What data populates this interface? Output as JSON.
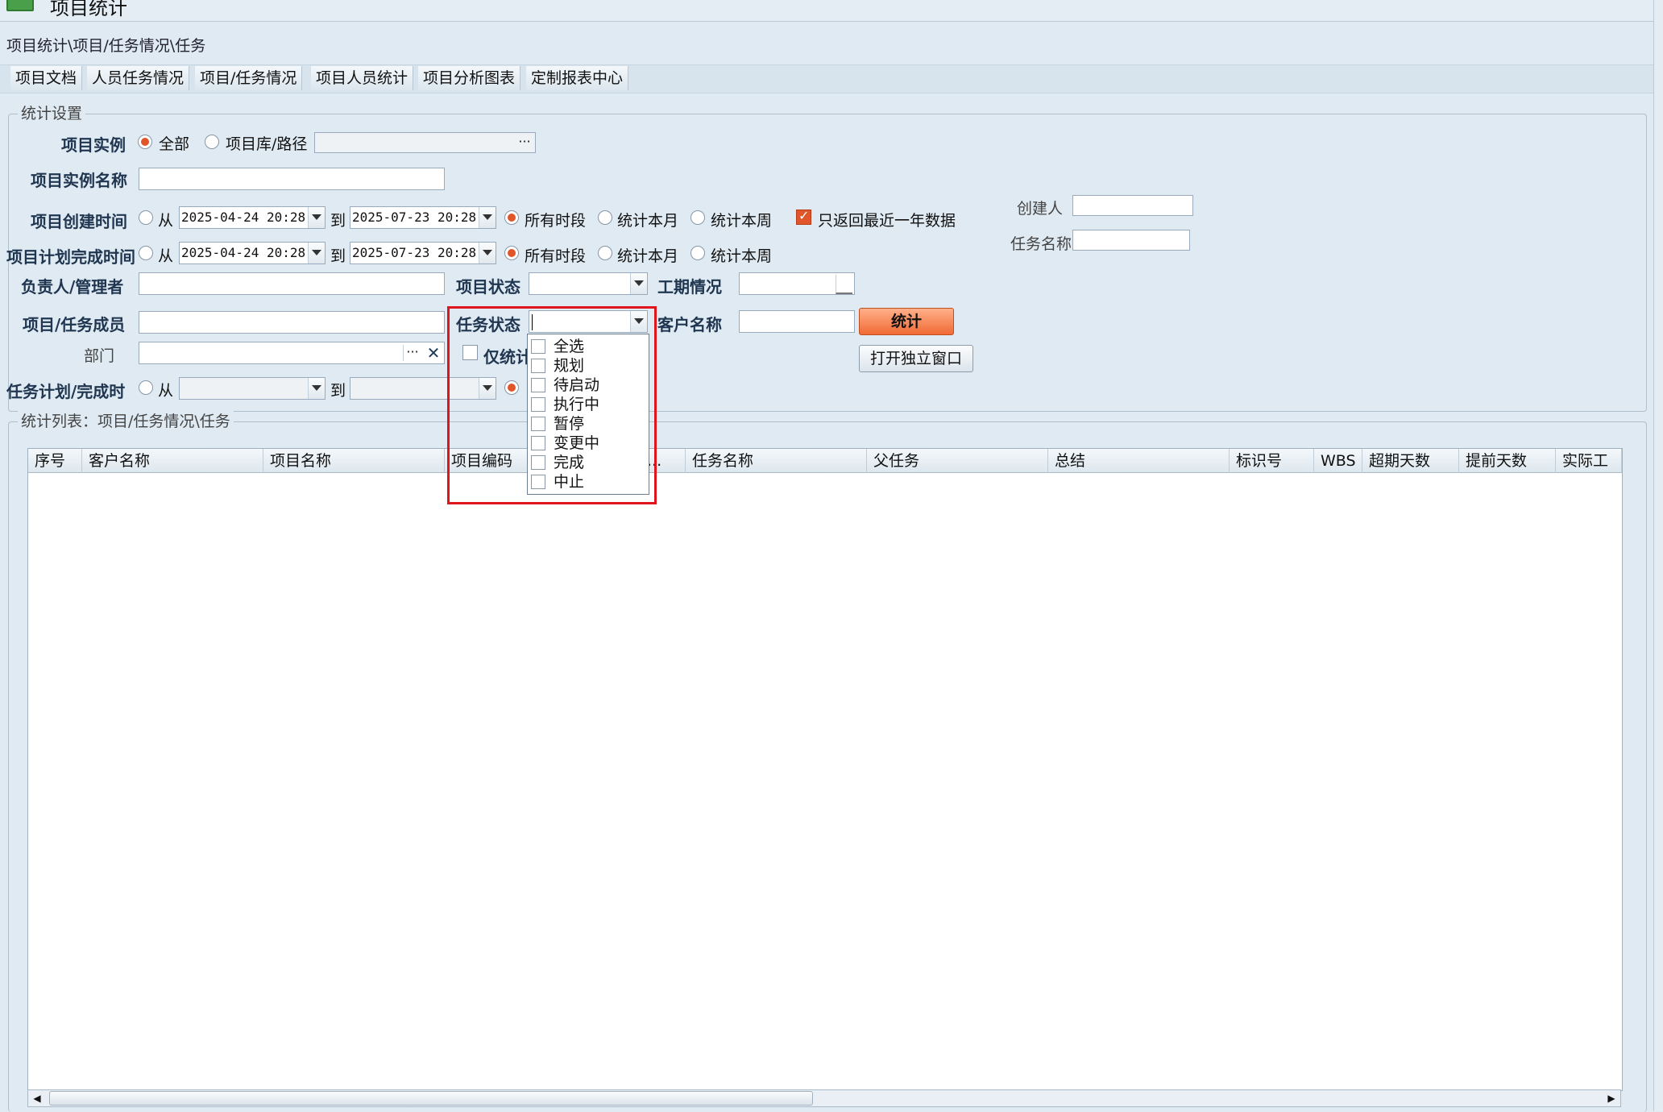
{
  "window": {
    "title": "项目统计"
  },
  "breadcrumb": "项目统计\\项目/任务情况\\任务",
  "tabs": [
    "项目文档",
    "人员任务情况",
    "项目/任务情况",
    "项目人员统计",
    "项目分析图表",
    "定制报表中心"
  ],
  "settings": {
    "legend": "统计设置",
    "instance": {
      "label": "项目实例",
      "opt_all": "全部",
      "opt_path": "项目库/路径"
    },
    "instance_name_label": "项目实例名称",
    "create_time": {
      "label": "项目创建时间",
      "from": "从",
      "from_value": "2025-04-24 20:28:",
      "to": "到",
      "to_value": "2025-07-23 20:28:",
      "opt_all": "所有时段",
      "opt_month": "统计本月",
      "opt_week": "统计本周",
      "last_year": "只返回最近一年数据"
    },
    "plan_time": {
      "label": "项目计划完成时间",
      "from": "从",
      "from_value": "2025-04-24 20:28:",
      "to": "到",
      "to_value": "2025-07-23 20:28:",
      "opt_all": "所有时段",
      "opt_month": "统计本月",
      "opt_week": "统计本周"
    },
    "creator_label": "创建人",
    "task_name_label": "任务名称",
    "manager_label": "负责人/管理者",
    "project_status_label": "项目状态",
    "duration_label": "工期情况",
    "member_label": "项目/任务成员",
    "task_status_label": "任务状态",
    "customer_label": "客户名称",
    "stat_button": "统计",
    "dept_label": "部门",
    "only_stat_label": "仅统计",
    "open_window_button": "打开独立窗口",
    "task_time": {
      "label": "任务计划/完成时",
      "from": "从",
      "to": "到"
    }
  },
  "list": {
    "legend": "统计列表：项目/任务情况\\任务",
    "columns": [
      "序号",
      "客户名称",
      "项目名称",
      "项目编码",
      "期...",
      "任务名称",
      "父任务",
      "总结",
      "标识号",
      "WBS",
      "超期天数",
      "提前天数",
      "实际工"
    ]
  },
  "dropdown": {
    "items": [
      "全选",
      "规划",
      "待启动",
      "执行中",
      "暂停",
      "变更中",
      "完成",
      "中止"
    ]
  },
  "colors": {
    "accent": "#e0552a",
    "highlight": "#e0151b"
  }
}
